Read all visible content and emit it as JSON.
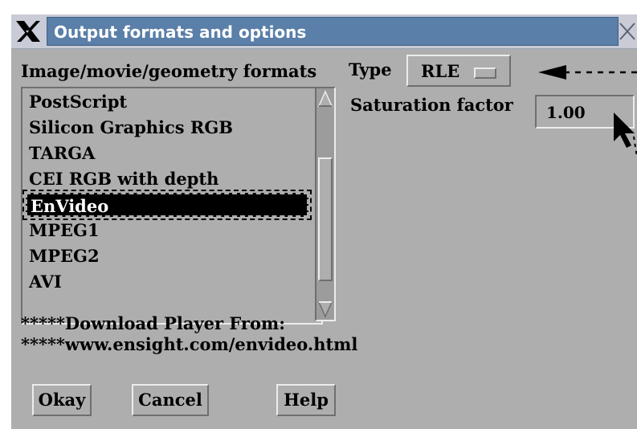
{
  "window": {
    "title": "Output formats and options"
  },
  "formats": {
    "label": "Image/movie/geometry formats",
    "items": [
      "PostScript",
      "Silicon Graphics RGB",
      "TARGA",
      "CEI RGB with depth",
      "EnVideo",
      "MPEG1",
      "MPEG2",
      "AVI"
    ],
    "selected": "EnVideo"
  },
  "type": {
    "label": "Type",
    "value": "RLE"
  },
  "saturation": {
    "label": "Saturation factor",
    "value": "1.00"
  },
  "notes": {
    "line1": "*****Download Player From:",
    "line2": "*****www.ensight.com/envideo.html"
  },
  "buttons": {
    "okay": "Okay",
    "cancel": "Cancel",
    "help": "Help"
  },
  "colors": {
    "panel": "#aeaeae",
    "title_bar": "#5a7fa8",
    "selection": "#000000"
  }
}
